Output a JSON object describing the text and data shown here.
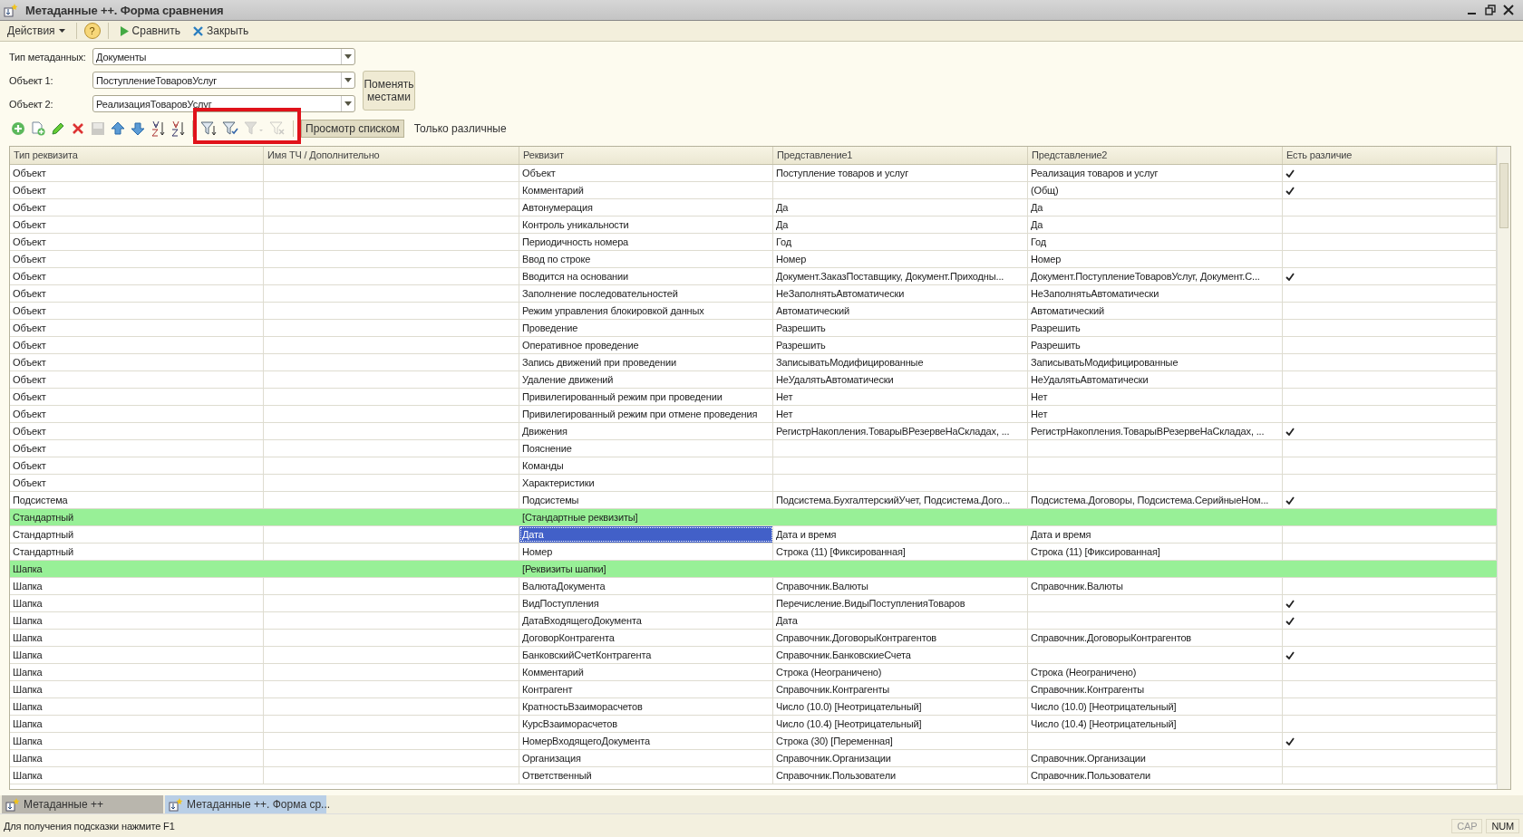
{
  "window": {
    "title": "Метаданные ++. Форма сравнения"
  },
  "menu": {
    "actions": "Действия",
    "help": "?",
    "buttons": [
      {
        "kind": "run",
        "label": "Сравнить"
      },
      {
        "kind": "close",
        "label": "Закрыть"
      }
    ]
  },
  "form": {
    "fields": [
      {
        "label": "Тип метаданных:",
        "value": "Документы"
      },
      {
        "label": "Объект 1:",
        "value": "ПоступлениеТоваровУслуг"
      },
      {
        "label": "Объект 2:",
        "value": "РеализацияТоваровУслуг"
      }
    ],
    "swap_button": "Поменять местами"
  },
  "table_toolbar": {
    "icons": [
      {
        "kind": "add",
        "disabled": false
      },
      {
        "kind": "copy",
        "disabled": false
      },
      {
        "kind": "edit",
        "disabled": false
      },
      {
        "kind": "delete",
        "disabled": false
      },
      {
        "kind": "save",
        "disabled": true
      },
      {
        "kind": "up",
        "disabled": false
      },
      {
        "kind": "down",
        "disabled": false
      },
      {
        "kind": "sort-asc",
        "disabled": false
      },
      {
        "kind": "sort-desc",
        "disabled": false
      },
      {
        "kind": "filter-set",
        "disabled": false
      },
      {
        "kind": "filter-check",
        "disabled": false
      },
      {
        "kind": "filter-menu",
        "disabled": true
      },
      {
        "kind": "filter-clear",
        "disabled": true
      }
    ],
    "toggles": [
      {
        "label": "Просмотр списком",
        "selected": true
      },
      {
        "label": "Только различные",
        "selected": false
      }
    ]
  },
  "table": {
    "columns": [
      "Тип реквизита",
      "Имя ТЧ / Дополнительно",
      "Реквизит",
      "Представление1",
      "Представление2",
      "Есть различие"
    ],
    "rows": [
      {
        "kind": "item",
        "type": "Объект",
        "attr": "Объект",
        "view1": "Поступление товаров и услуг",
        "view2": "Реализация товаров и услуг",
        "differs": true,
        "selected": false
      },
      {
        "kind": "item",
        "type": "Объект",
        "attr": "Комментарий",
        "view2": "(Общ)",
        "differs": true,
        "selected": false
      },
      {
        "kind": "item",
        "type": "Объект",
        "attr": "Автонумерация",
        "view1": "Да",
        "view2": "Да",
        "differs": false,
        "selected": false
      },
      {
        "kind": "item",
        "type": "Объект",
        "attr": "Контроль уникальности",
        "view1": "Да",
        "view2": "Да",
        "differs": false,
        "selected": false
      },
      {
        "kind": "item",
        "type": "Объект",
        "attr": "Периодичность номера",
        "view1": "Год",
        "view2": "Год",
        "differs": false,
        "selected": false
      },
      {
        "kind": "item",
        "type": "Объект",
        "attr": "Ввод по строке",
        "view1": "Номер",
        "view2": "Номер",
        "differs": false,
        "selected": false
      },
      {
        "kind": "item",
        "type": "Объект",
        "attr": "Вводится на основании",
        "view1": "Документ.ЗаказПоставщику, Документ.Приходны...",
        "view2": "Документ.ПоступлениеТоваровУслуг, Документ.С...",
        "differs": true,
        "selected": false
      },
      {
        "kind": "item",
        "type": "Объект",
        "attr": "Заполнение последовательностей",
        "view1": "НеЗаполнятьАвтоматически",
        "view2": "НеЗаполнятьАвтоматически",
        "differs": false,
        "selected": false
      },
      {
        "kind": "item",
        "type": "Объект",
        "attr": "Режим управления блокировкой данных",
        "view1": "Автоматический",
        "view2": "Автоматический",
        "differs": false,
        "selected": false
      },
      {
        "kind": "item",
        "type": "Объект",
        "attr": "Проведение",
        "view1": "Разрешить",
        "view2": "Разрешить",
        "differs": false,
        "selected": false
      },
      {
        "kind": "item",
        "type": "Объект",
        "attr": "Оперативное проведение",
        "view1": "Разрешить",
        "view2": "Разрешить",
        "differs": false,
        "selected": false
      },
      {
        "kind": "item",
        "type": "Объект",
        "attr": "Запись движений при проведении",
        "view1": "ЗаписыватьМодифицированные",
        "view2": "ЗаписыватьМодифицированные",
        "differs": false,
        "selected": false
      },
      {
        "kind": "item",
        "type": "Объект",
        "attr": "Удаление движений",
        "view1": "НеУдалятьАвтоматически",
        "view2": "НеУдалятьАвтоматически",
        "differs": false,
        "selected": false
      },
      {
        "kind": "item",
        "type": "Объект",
        "attr": "Привилегированный режим при проведении",
        "view1": "Нет",
        "view2": "Нет",
        "differs": false,
        "selected": false
      },
      {
        "kind": "item",
        "type": "Объект",
        "attr": "Привилегированный режим при отмене проведения",
        "view1": "Нет",
        "view2": "Нет",
        "differs": false,
        "selected": false
      },
      {
        "kind": "item",
        "type": "Объект",
        "attr": "Движения",
        "view1": "РегистрНакопления.ТоварыВРезервеНаСкладах, ...",
        "view2": "РегистрНакопления.ТоварыВРезервеНаСкладах, ...",
        "differs": true,
        "selected": false
      },
      {
        "kind": "item",
        "type": "Объект",
        "attr": "Пояснение",
        "differs": false,
        "selected": false
      },
      {
        "kind": "item",
        "type": "Объект",
        "attr": "Команды",
        "differs": false,
        "selected": false
      },
      {
        "kind": "item",
        "type": "Объект",
        "attr": "Характеристики",
        "differs": false,
        "selected": false
      },
      {
        "kind": "item",
        "type": "Подсистема",
        "attr": "Подсистемы",
        "view1": "Подсистема.БухгалтерскийУчет, Подсистема.Дого...",
        "view2": "Подсистема.Договоры, Подсистема.СерийныеНом...",
        "differs": true,
        "selected": false
      },
      {
        "kind": "group",
        "type": "Стандартный",
        "attr": "[Стандартные реквизиты]",
        "differs": false,
        "selected": false
      },
      {
        "kind": "item",
        "type": "Стандартный",
        "attr": "Дата",
        "view1": "Дата и время",
        "view2": "Дата и время",
        "differs": false,
        "selected": true
      },
      {
        "kind": "item",
        "type": "Стандартный",
        "attr": "Номер",
        "view1": "Строка (11) [Фиксированная]",
        "view2": "Строка (11) [Фиксированная]",
        "differs": false,
        "selected": false
      },
      {
        "kind": "group",
        "type": "Шапка",
        "attr": "[Реквизиты шапки]",
        "differs": false,
        "selected": false
      },
      {
        "kind": "item",
        "type": "Шапка",
        "attr": "ВалютаДокумента",
        "view1": "Справочник.Валюты",
        "view2": "Справочник.Валюты",
        "differs": false,
        "selected": false
      },
      {
        "kind": "item",
        "type": "Шапка",
        "attr": "ВидПоступления",
        "view1": "Перечисление.ВидыПоступленияТоваров",
        "differs": true,
        "selected": false
      },
      {
        "kind": "item",
        "type": "Шапка",
        "attr": "ДатаВходящегоДокумента",
        "view1": "Дата",
        "differs": true,
        "selected": false
      },
      {
        "kind": "item",
        "type": "Шапка",
        "attr": "ДоговорКонтрагента",
        "view1": "Справочник.ДоговорыКонтрагентов",
        "view2": "Справочник.ДоговорыКонтрагентов",
        "differs": false,
        "selected": false
      },
      {
        "kind": "item",
        "type": "Шапка",
        "attr": "БанковскийСчетКонтрагента",
        "view1": "Справочник.БанковскиеСчета",
        "differs": true,
        "selected": false
      },
      {
        "kind": "item",
        "type": "Шапка",
        "attr": "Комментарий",
        "view1": "Строка (Неограничено)",
        "view2": "Строка (Неограничено)",
        "differs": false,
        "selected": false
      },
      {
        "kind": "item",
        "type": "Шапка",
        "attr": "Контрагент",
        "view1": "Справочник.Контрагенты",
        "view2": "Справочник.Контрагенты",
        "differs": false,
        "selected": false
      },
      {
        "kind": "item",
        "type": "Шапка",
        "attr": "КратностьВзаиморасчетов",
        "view1": "Число (10.0) [Неотрицательный]",
        "view2": "Число (10.0) [Неотрицательный]",
        "differs": false,
        "selected": false
      },
      {
        "kind": "item",
        "type": "Шапка",
        "attr": "КурсВзаиморасчетов",
        "view1": "Число (10.4) [Неотрицательный]",
        "view2": "Число (10.4) [Неотрицательный]",
        "differs": false,
        "selected": false
      },
      {
        "kind": "item",
        "type": "Шапка",
        "attr": "НомерВходящегоДокумента",
        "view1": "Строка (30) [Переменная]",
        "differs": true,
        "selected": false
      },
      {
        "kind": "item",
        "type": "Шапка",
        "attr": "Организация",
        "view1": "Справочник.Организации",
        "view2": "Справочник.Организации",
        "differs": false,
        "selected": false
      },
      {
        "kind": "item",
        "type": "Шапка",
        "attr": "Ответственный",
        "view1": "Справочник.Пользователи",
        "view2": "Справочник.Пользователи",
        "differs": false,
        "selected": false
      }
    ]
  },
  "taskbar": [
    {
      "label": "Метаданные ++",
      "selected": false
    },
    {
      "label": "Метаданные ++. Форма ср...",
      "selected": true
    }
  ],
  "status_bar": {
    "hint": "Для получения подсказки нажмите F1",
    "indicators": [
      {
        "label": "CAP",
        "on": false
      },
      {
        "label": "NUM",
        "on": true
      }
    ]
  }
}
